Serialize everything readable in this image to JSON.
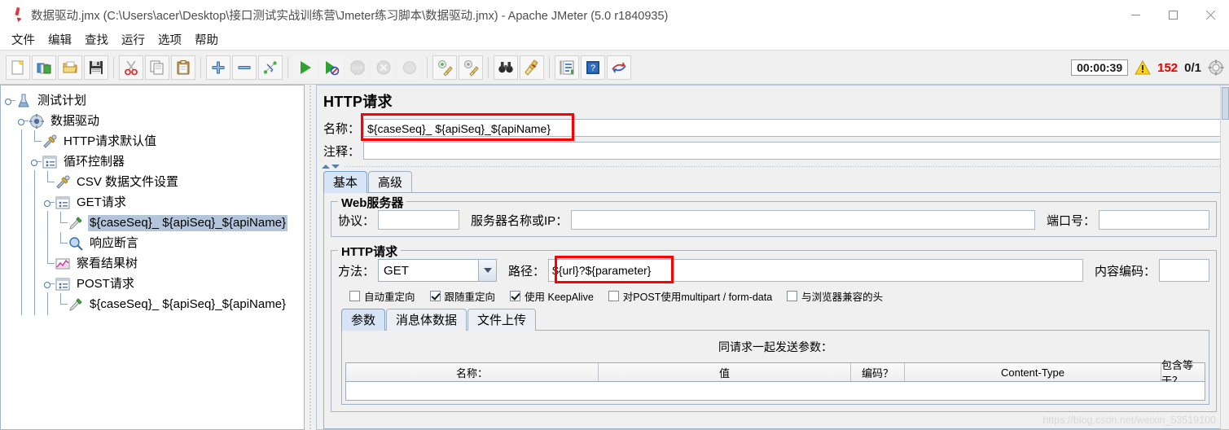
{
  "window": {
    "title": "数据驱动.jmx (C:\\Users\\acer\\Desktop\\接口测试实战训练营\\Jmeter练习脚本\\数据驱动.jmx) - Apache JMeter (5.0 r1840935)",
    "app_icon": "jmeter-feather-icon",
    "minimize_label": "—",
    "maximize_label": "□",
    "close_label": "✕"
  },
  "menubar": {
    "items": [
      {
        "label": "文件",
        "name": "menu-file"
      },
      {
        "label": "编辑",
        "name": "menu-edit"
      },
      {
        "label": "查找",
        "name": "menu-search"
      },
      {
        "label": "运行",
        "name": "menu-run"
      },
      {
        "label": "选项",
        "name": "menu-options"
      },
      {
        "label": "帮助",
        "name": "menu-help"
      }
    ]
  },
  "toolbar": {
    "buttons": [
      {
        "icon": "new-document-icon"
      },
      {
        "icon": "templates-icon"
      },
      {
        "icon": "open-folder-icon"
      },
      {
        "icon": "save-floppy-icon"
      },
      {
        "icon": "cut-scissors-icon"
      },
      {
        "icon": "copy-icon"
      },
      {
        "icon": "paste-clipboard-icon"
      },
      {
        "icon": "expand-plus-icon"
      },
      {
        "icon": "collapse-minus-icon"
      },
      {
        "icon": "toggle-switch-icon"
      },
      {
        "icon": "start-play-icon"
      },
      {
        "icon": "start-no-timers-icon"
      },
      {
        "icon": "stop-icon"
      },
      {
        "icon": "shutdown-icon"
      },
      {
        "icon": "clear-icon"
      },
      {
        "icon": "clear-all-icon"
      },
      {
        "icon": "search-binoculars-icon"
      },
      {
        "icon": "reset-search-broom-icon"
      },
      {
        "icon": "function-helper-icon"
      },
      {
        "icon": "help-book-icon"
      },
      {
        "icon": "undo-redo-icon"
      }
    ],
    "timer": "00:00:39",
    "warning_icon": "warning-triangle-icon",
    "warning_count": "152",
    "threads": "0/1",
    "gear_icon": "activity-gear-icon"
  },
  "tree": {
    "nodes": [
      {
        "label": "测试计划",
        "icon": "test-plan-icon",
        "depth": 0,
        "selected": false
      },
      {
        "label": "数据驱动",
        "icon": "thread-group-icon",
        "depth": 1,
        "selected": false
      },
      {
        "label": "HTTP请求默认值",
        "icon": "config-wrench-icon",
        "depth": 2,
        "selected": false
      },
      {
        "label": "循环控制器",
        "icon": "controller-icon",
        "depth": 2,
        "selected": false
      },
      {
        "label": "CSV 数据文件设置",
        "icon": "config-wrench-icon",
        "depth": 3,
        "selected": false
      },
      {
        "label": "GET请求",
        "icon": "controller-icon",
        "depth": 3,
        "selected": false
      },
      {
        "label": "${caseSeq}_ ${apiSeq}_${apiName}",
        "icon": "http-sampler-icon",
        "depth": 4,
        "selected": true
      },
      {
        "label": "响应断言",
        "icon": "assertion-magnifier-icon",
        "depth": 4,
        "selected": false
      },
      {
        "label": "察看结果树",
        "icon": "view-results-tree-icon",
        "depth": 3,
        "selected": false
      },
      {
        "label": "POST请求",
        "icon": "controller-icon",
        "depth": 3,
        "selected": false
      },
      {
        "label": "${caseSeq}_ ${apiSeq}_${apiName}",
        "icon": "http-sampler-icon",
        "depth": 4,
        "selected": false
      }
    ]
  },
  "panel": {
    "title": "HTTP请求",
    "name_label": "名称：",
    "name_value": "${caseSeq}_ ${apiSeq}_${apiName}",
    "comment_label": "注释：",
    "comment_value": "",
    "tabs": [
      {
        "label": "基本",
        "active": true
      },
      {
        "label": "高级",
        "active": false
      }
    ],
    "web_server": {
      "legend": "Web服务器",
      "protocol_label": "协议：",
      "protocol_value": "",
      "server_label": "服务器名称或IP：",
      "server_value": "",
      "port_label": "端口号：",
      "port_value": ""
    },
    "http_request": {
      "legend": "HTTP请求",
      "method_label": "方法：",
      "method_value": "GET",
      "path_label": "路径：",
      "path_value": "${url}?${parameter}",
      "encoding_label": "内容编码：",
      "encoding_value": ""
    },
    "checkboxes": [
      {
        "label": "自动重定向",
        "checked": false
      },
      {
        "label": "跟随重定向",
        "checked": true
      },
      {
        "label": "使用 KeepAlive",
        "checked": true
      },
      {
        "label": "对POST使用multipart / form-data",
        "checked": false
      },
      {
        "label": "与浏览器兼容的头",
        "checked": false
      }
    ],
    "sub_tabs": [
      {
        "label": "参数",
        "active": true
      },
      {
        "label": "消息体数据",
        "active": false
      },
      {
        "label": "文件上传",
        "active": false
      }
    ],
    "params": {
      "title": "同请求一起发送参数：",
      "columns": [
        "名称：",
        "值",
        "编码？",
        "Content-Type",
        "包含等于？"
      ],
      "rows": []
    }
  },
  "watermark": "https://blog.csdn.net/weixin_53519100",
  "colors": {
    "selection": "#b3c5da",
    "highlight_red": "#ff0000",
    "warning_red": "#e00000",
    "tab_active": "#d6e4f5"
  }
}
